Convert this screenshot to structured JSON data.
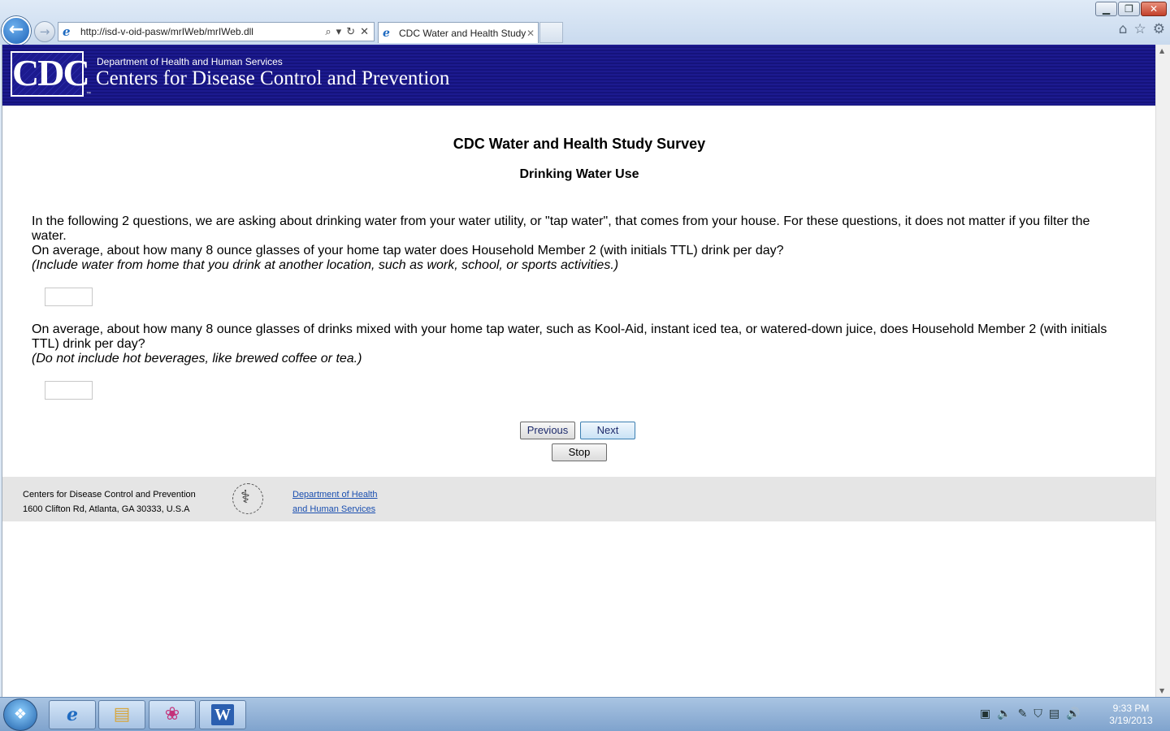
{
  "browser": {
    "window_controls": {
      "minimize": "▁",
      "restore": "❐",
      "close": "✕"
    },
    "back_glyph": "←",
    "forward_glyph": "→",
    "address": {
      "url": "http://isd-v-oid-pasw/mrIWeb/mrIWeb.dll",
      "icon": "ie-icon",
      "tools": [
        "⌕",
        "▾",
        "↻",
        "✕"
      ]
    },
    "tab": {
      "label": "CDC Water and Health Study",
      "close": "✕"
    },
    "toolbar_icons": [
      "⌂",
      "☆",
      "⚙"
    ]
  },
  "header": {
    "logo_text": "CDC",
    "trademark": "™",
    "department": "Department of Health and Human Services",
    "agency": "Centers for Disease Control and Prevention"
  },
  "survey": {
    "title": "CDC Water and Health Study Survey",
    "section": "Drinking Water Use",
    "intro": "In the following 2 questions, we are asking about drinking water from your water utility, or \"tap water\", that comes from your house. For these questions, it does not matter if you filter the water.",
    "questions": [
      {
        "text": "On average, about how many 8 ounce glasses of your home tap water does Household Member 2 (with initials TTL) drink per day?",
        "note": "(Include water from home that you drink at another location, such as work, school, or sports activities.)",
        "value": ""
      },
      {
        "text": "On average, about how many 8 ounce glasses of drinks mixed with your home tap water, such as Kool-Aid, instant iced tea, or watered-down juice, does Household Member 2 (with initials TTL) drink per day?",
        "note": "(Do not include hot beverages, like brewed coffee or tea.)",
        "value": ""
      }
    ],
    "buttons": {
      "previous": "Previous",
      "next": "Next",
      "stop": "Stop"
    }
  },
  "footer": {
    "org_name": "Centers for Disease Control and Prevention",
    "address": "1600 Clifton Rd, Atlanta, GA 30333, U.S.A",
    "hhs_link_line1": "Department of Health",
    "hhs_link_line2": "and Human Services"
  },
  "taskbar": {
    "start_glyph": "❖",
    "apps": [
      "ie-icon",
      "folder-icon",
      "media-app-icon",
      "word-icon"
    ],
    "word_letter": "W",
    "tray_icons": [
      "▣",
      "🔈",
      "✎",
      "⛉",
      "▤",
      "🔊"
    ],
    "time": "9:33 PM",
    "date": "3/19/2013"
  }
}
